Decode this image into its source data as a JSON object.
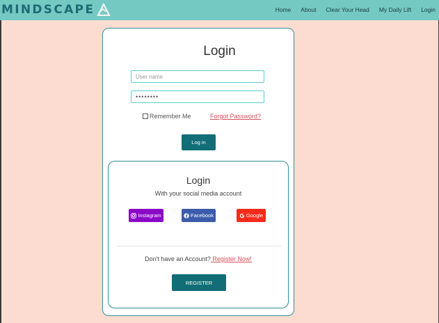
{
  "brand": {
    "name": "MINDSCAPE",
    "logo_icon": "mountain-a-icon",
    "color": "#1d6b73"
  },
  "nav": {
    "items": [
      {
        "label": "Home"
      },
      {
        "label": "About"
      },
      {
        "label": "Clear Your Head"
      },
      {
        "label": "My Daily Lift"
      },
      {
        "label": "Login"
      }
    ]
  },
  "login": {
    "title": "Login",
    "username_placeholder": "User name",
    "password_value": "••••••••",
    "remember_label": "Remember Me",
    "forgot_label": "Forgot Password?",
    "submit_label": "Log in"
  },
  "social": {
    "title": "Login",
    "subtitle": "With your social media account",
    "buttons": [
      {
        "label": "Instagram",
        "icon": "instagram-icon",
        "color": "#8b08c8"
      },
      {
        "label": "Facebook",
        "icon": "facebook-icon",
        "color": "#3b5bab"
      },
      {
        "label": "Google",
        "icon": "google-icon",
        "color": "#f62b1c"
      }
    ]
  },
  "register": {
    "prompt": "Don't have an Account?",
    "link_label": " Register Now!",
    "button_label": "REGISTER"
  },
  "colors": {
    "accent": "#116d76",
    "nav_bg": "#74c9c3",
    "page_bg": "#fcdcd0",
    "link": "#d4505a"
  }
}
